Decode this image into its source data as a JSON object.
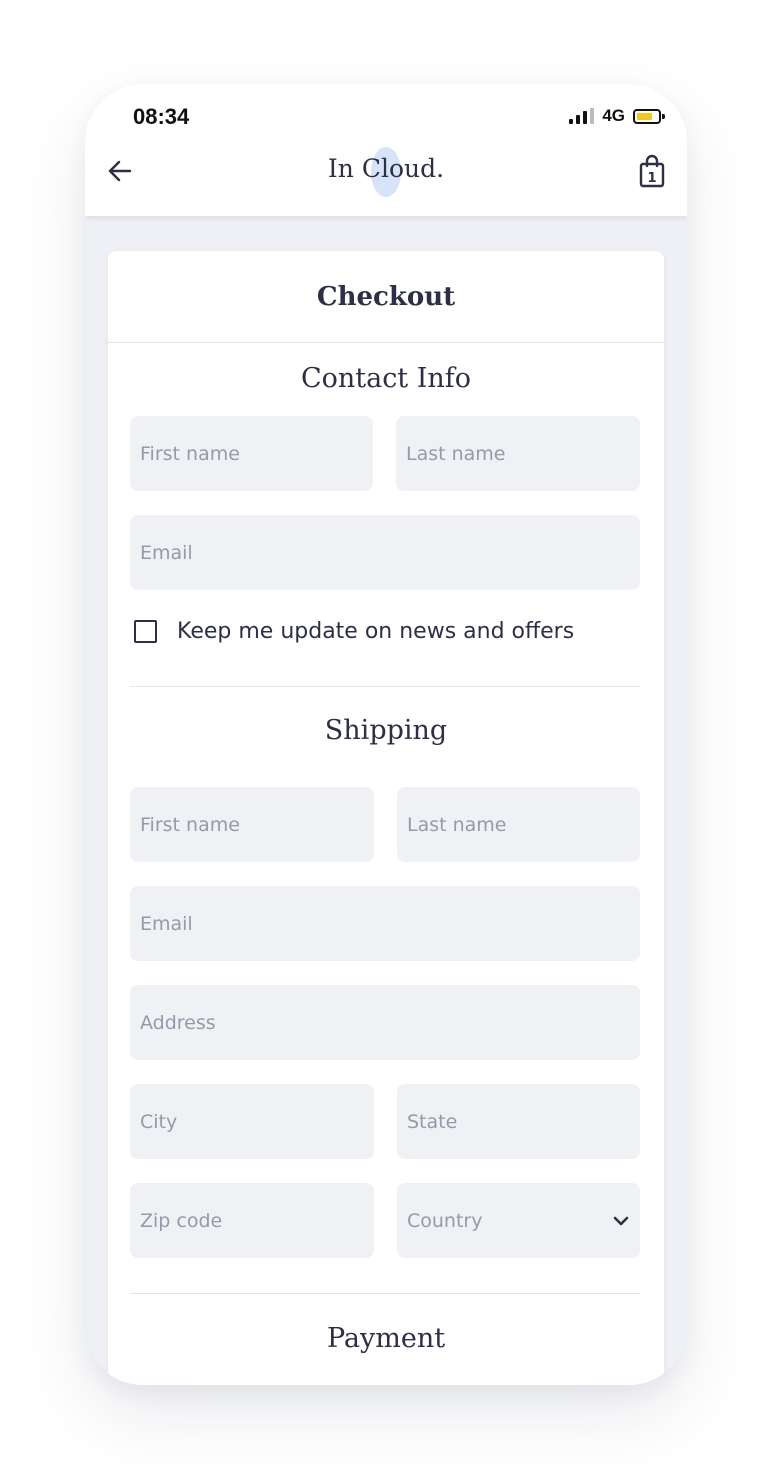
{
  "status_bar": {
    "time": "08:34",
    "network": "4G",
    "battery_color": "#f3c623"
  },
  "nav": {
    "back_icon": "arrow-left-icon",
    "brand": "In Cloud.",
    "bag_icon": "shopping-bag-icon",
    "bag_count": "1"
  },
  "checkout": {
    "title": "Checkout",
    "contact": {
      "title": "Contact Info",
      "first_name_placeholder": "First name",
      "last_name_placeholder": "Last name",
      "email_placeholder": "Email",
      "newsletter_label": "Keep me update on news and offers"
    },
    "shipping": {
      "title": "Shipping",
      "first_name_placeholder": "First name",
      "last_name_placeholder": "Last name",
      "email_placeholder": "Email",
      "address_placeholder": "Address",
      "city_placeholder": "City",
      "state_placeholder": "State",
      "zip_placeholder": "Zip code",
      "country_placeholder": "Country"
    },
    "payment": {
      "title": "Payment"
    }
  },
  "colors": {
    "text_dark": "#2d2f45",
    "field_bg": "#f0f1f5",
    "placeholder": "#9898a8",
    "page_bg": "#eef0f5"
  }
}
